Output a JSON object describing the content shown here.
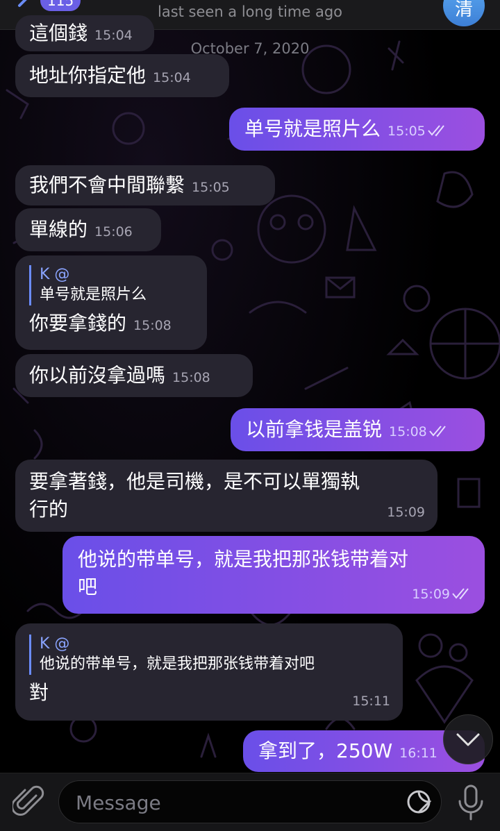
{
  "header": {
    "back_count": "115",
    "status": "last seen a long time ago",
    "avatar_letter": "清"
  },
  "date_separator": "October 7, 2020",
  "messages": [
    {
      "text": "這個錢",
      "time": "15:04"
    },
    {
      "text": "地址你指定他",
      "time": "15:04"
    },
    {
      "text": "单号就是照片么",
      "time": "15:05"
    },
    {
      "text": "我們不會中間聯繫",
      "time": "15:05"
    },
    {
      "text": "單線的",
      "time": "15:06"
    },
    {
      "quote_name": "K @",
      "quote_text": "单号就是照片么",
      "text": "你要拿錢的",
      "time": "15:08"
    },
    {
      "text": "你以前沒拿過嗎",
      "time": "15:08"
    },
    {
      "text": "以前拿钱是盖锐",
      "time": "15:08"
    },
    {
      "line1": "要拿著錢，他是司機，是不可以單獨執",
      "line2": "行的",
      "time": "15:09"
    },
    {
      "line1": "他说的带单号，就是我把那张钱带着对",
      "line2": "吧",
      "time": "15:09"
    },
    {
      "quote_name": "K @",
      "quote_text": "他说的带单号，就是我把那张钱带着对吧",
      "text": "對",
      "time": "15:11"
    },
    {
      "text": "拿到了，250W",
      "time": "16:11"
    }
  ],
  "input": {
    "placeholder": "Message"
  },
  "colors": {
    "incoming_bubble": "#272530",
    "outgoing_start": "#6a4fe8",
    "outgoing_end": "#9b4fe0",
    "quote_accent": "#6b8cff"
  },
  "icons": [
    "chevron-left-icon",
    "paperclip-icon",
    "sticker-icon",
    "microphone-icon",
    "chevron-down-icon",
    "double-check-icon"
  ]
}
